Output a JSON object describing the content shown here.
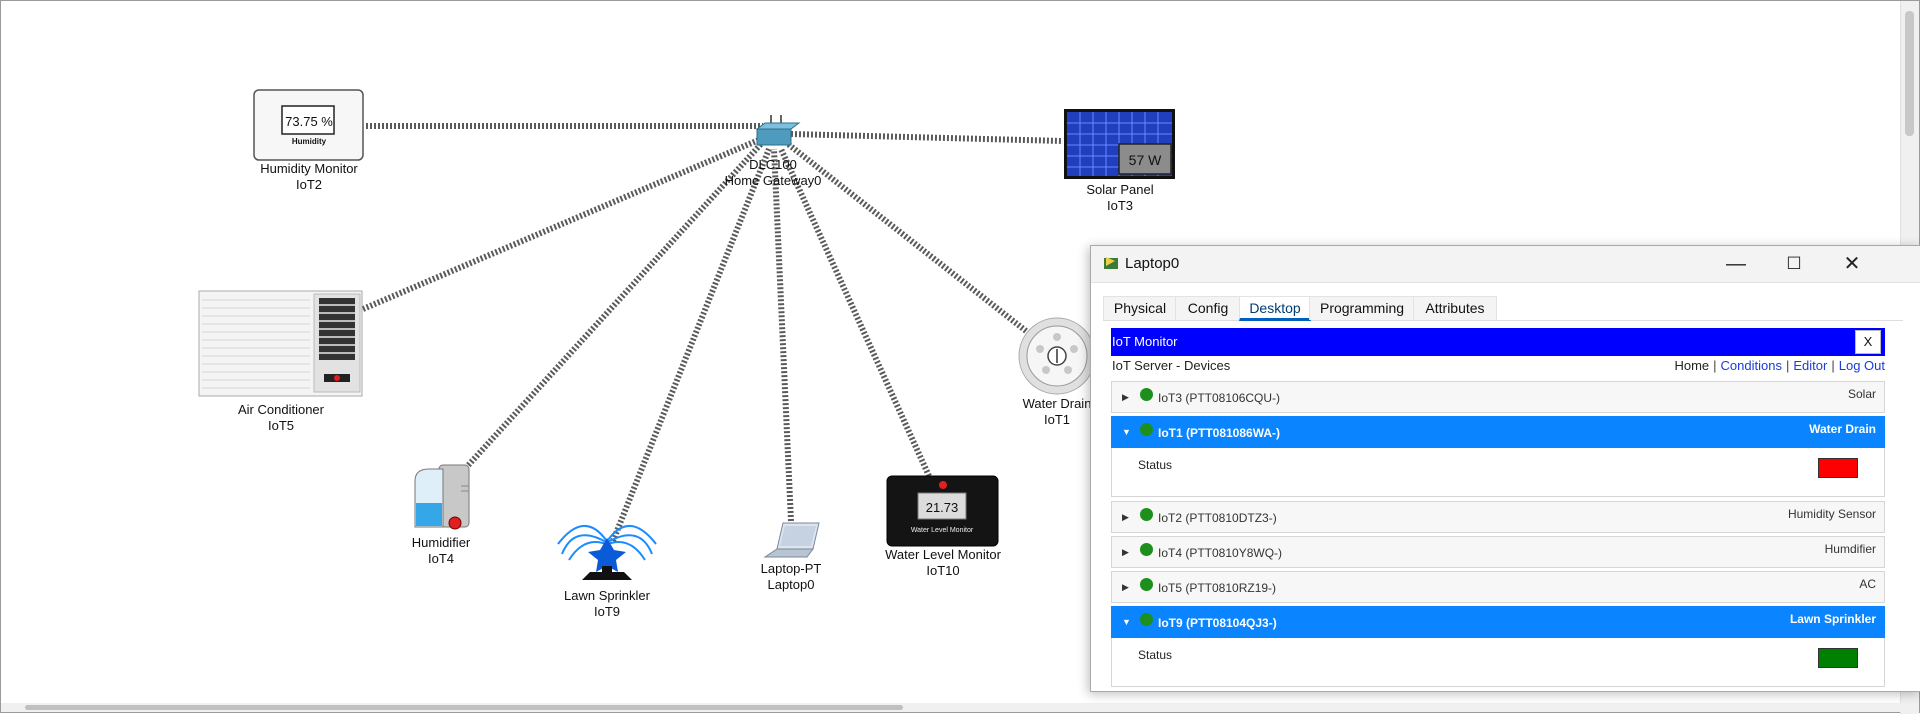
{
  "topology": {
    "devices": [
      {
        "id": "humidity-monitor",
        "line1": "Humidity Monitor",
        "line2": "IoT2",
        "display": "73.75 %",
        "sublabel": "Humidity"
      },
      {
        "id": "gateway",
        "line1": "DLC100",
        "line2": "Home Gateway0"
      },
      {
        "id": "solar-panel",
        "line1": "Solar Panel",
        "line2": "IoT3",
        "display": "57 W"
      },
      {
        "id": "air-conditioner",
        "line1": "Air Conditioner",
        "line2": "IoT5"
      },
      {
        "id": "water-drain",
        "line1": "Water Drain",
        "line2": "IoT1"
      },
      {
        "id": "humidifier",
        "line1": "Humidifier",
        "line2": "IoT4"
      },
      {
        "id": "lawn-sprinkler",
        "line1": "Lawn Sprinkler",
        "line2": "IoT9"
      },
      {
        "id": "laptop",
        "line1": "Laptop-PT",
        "line2": "Laptop0"
      },
      {
        "id": "water-level-monitor",
        "line1": "Water Level Monitor",
        "line2": "IoT10",
        "display": "21.73",
        "sublabel": "Water Level Monitor"
      }
    ]
  },
  "window": {
    "title": "Laptop0",
    "tabs": [
      "Physical",
      "Config",
      "Desktop",
      "Programming",
      "Attributes"
    ],
    "active_tab": "Desktop",
    "app_bar_title": "IoT Monitor",
    "close_label": "X",
    "subtitle": "IoT Server - Devices",
    "nav": {
      "home": "Home",
      "sep": "|",
      "conditions": "Conditions",
      "editor": "Editor",
      "logout": "Log Out"
    },
    "devices": [
      {
        "name": "IoT3 (PTT08106CQU-)",
        "type": "Solar",
        "expanded": false
      },
      {
        "name": "IoT1 (PTT081086WA-)",
        "type": "Water Drain",
        "expanded": true,
        "status_label": "Status",
        "status_color": "#ff0000"
      },
      {
        "name": "IoT2 (PTT0810DTZ3-)",
        "type": "Humidity Sensor",
        "expanded": false
      },
      {
        "name": "IoT4 (PTT0810Y8WQ-)",
        "type": "Humdifier",
        "expanded": false
      },
      {
        "name": "IoT5 (PTT0810RZ19-)",
        "type": "AC",
        "expanded": false
      },
      {
        "name": "IoT9 (PTT08104QJ3-)",
        "type": "Lawn Sprinkler",
        "expanded": true,
        "status_label": "Status",
        "status_color": "#008000"
      }
    ]
  },
  "colors": {
    "accent_blue": "#0a84ff",
    "iot_bar": "#0000ff",
    "status_dot": "#1d8f1d"
  }
}
